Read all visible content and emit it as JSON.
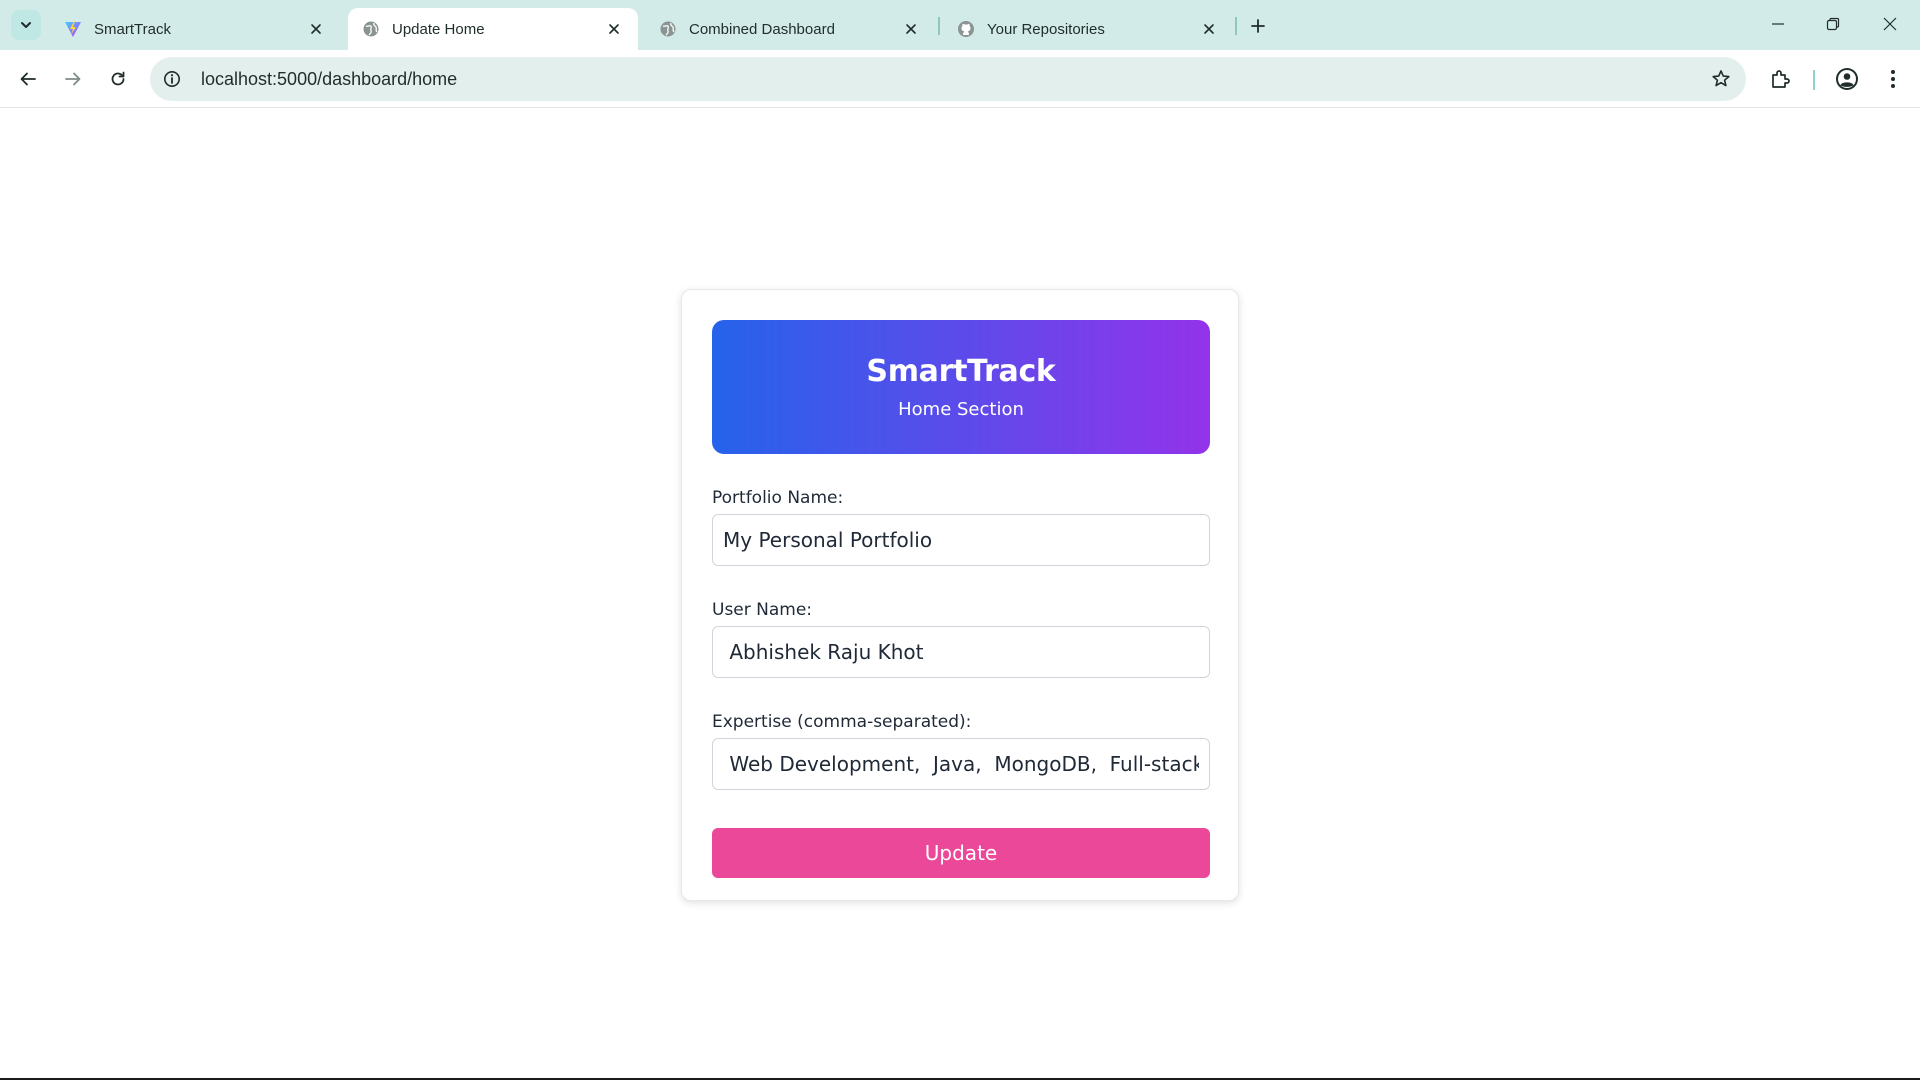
{
  "browser": {
    "tabs": [
      {
        "title": "SmartTrack",
        "icon": "vite-logo-icon",
        "active": false
      },
      {
        "title": "Update Home",
        "icon": "globe-icon",
        "active": true
      },
      {
        "title": "Combined Dashboard",
        "icon": "globe-icon",
        "active": false
      },
      {
        "title": "Your Repositories",
        "icon": "github-icon",
        "active": false
      }
    ],
    "url": "localhost:5000/dashboard/home",
    "colors": {
      "tabstrip": "#d3ebe8",
      "omnibox": "#e3efed"
    }
  },
  "page": {
    "header": {
      "brand": "SmartTrack",
      "subtitle": "Home Section",
      "gradient_from": "#2563eb",
      "gradient_to": "#9333ea"
    },
    "form": {
      "portfolio_name_label": "Portfolio Name:",
      "portfolio_name_value": "My Personal Portfolio",
      "user_name_label": "User Name:",
      "user_name_value": " Abhishek Raju Khot",
      "expertise_label": "Expertise (comma-separated):",
      "expertise_value": " Web Development,  Java,  MongoDB,  Full-stack Development",
      "submit_label": "Update",
      "submit_color": "#ec4899"
    }
  }
}
